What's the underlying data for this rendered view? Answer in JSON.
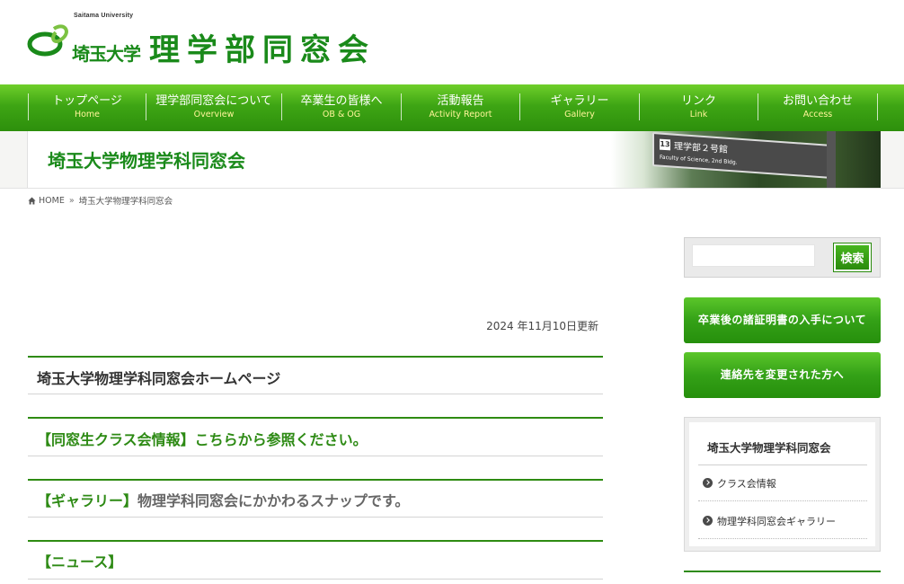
{
  "header": {
    "univ_en": "Saitama University",
    "univ_jp": "埼玉大学",
    "site_title": "理学部同窓会",
    "brand_color": "#1a8a1a"
  },
  "nav": [
    {
      "jp": "トップページ",
      "en": "Home"
    },
    {
      "jp": "理学部同窓会について",
      "en": "Overview"
    },
    {
      "jp": "卒業生の皆様へ",
      "en": "OB & OG"
    },
    {
      "jp": "活動報告",
      "en": "Activity Report"
    },
    {
      "jp": "ギャラリー",
      "en": "Gallery"
    },
    {
      "jp": "リンク",
      "en": "Link"
    },
    {
      "jp": "お問い合わせ",
      "en": "Access"
    }
  ],
  "page_title": "埼玉大学物理学科同窓会",
  "sign": {
    "num": "13",
    "jp": "理学部２号館",
    "en": "Faculty of Science, 2nd Bldg."
  },
  "breadcrumb": {
    "home": "HOME",
    "current": "埼玉大学物理学科同窓会"
  },
  "main": {
    "updated": "2024 年11月10日更新",
    "heading_home": "埼玉大学物理学科同窓会ホームページ",
    "heading_class": "【同窓生クラス会情報】こちらから参照ください。",
    "heading_gallery_tag": "【ギャラリー】",
    "heading_gallery_text": "物理学科同窓会にかかわるスナップです。",
    "heading_news": "【ニュース】"
  },
  "sidebar": {
    "search_placeholder": "",
    "search_button": "検索",
    "btn_certificate": "卒業後の諸証明書の入手について",
    "btn_contact_change": "連絡先を変更された方へ",
    "menu_title": "埼玉大学物理学科同窓会",
    "menu_items": [
      "クラス会情報",
      "物理学科同窓会ギャラリー"
    ]
  }
}
